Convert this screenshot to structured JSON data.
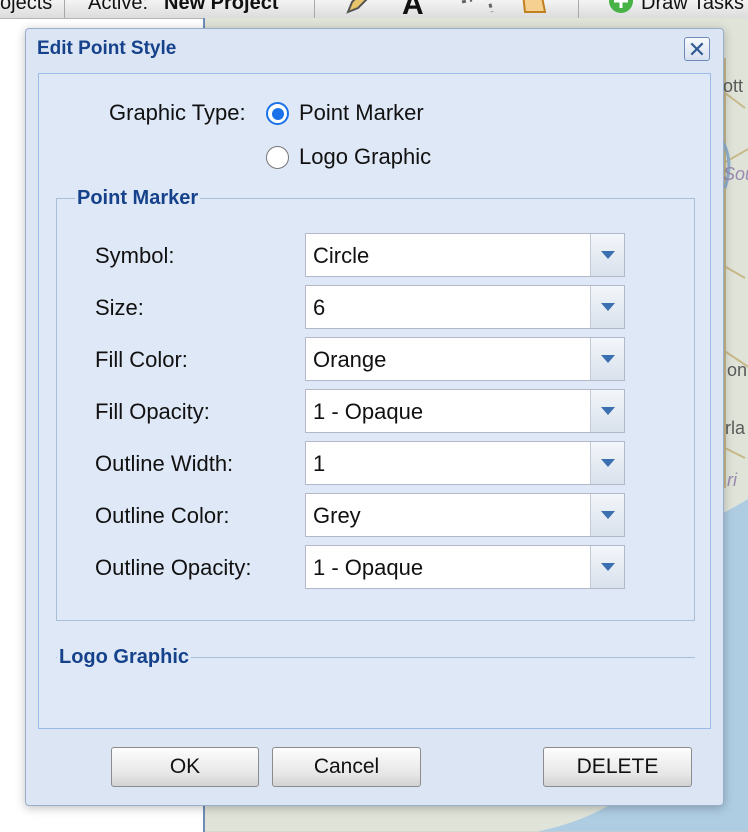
{
  "toolbar": {
    "projects_label": "ojects",
    "active_prefix": "Active:",
    "active_project": "New Project",
    "draw_tasks_label": "Draw Tasks"
  },
  "map": {
    "labels": [
      "ott",
      "Sou",
      "on",
      "rla",
      "ri"
    ]
  },
  "dialog": {
    "title": "Edit Point Style",
    "close_icon": "✕",
    "graphic_type_label": "Graphic Type:",
    "graphic_type_options": [
      {
        "label": "Point Marker",
        "checked": true
      },
      {
        "label": "Logo Graphic",
        "checked": false
      }
    ],
    "point_marker": {
      "legend": "Point Marker",
      "fields": [
        {
          "label": "Symbol:",
          "value": "Circle"
        },
        {
          "label": "Size:",
          "value": "6"
        },
        {
          "label": "Fill Color:",
          "value": "Orange"
        },
        {
          "label": "Fill Opacity:",
          "value": "1 - Opaque"
        },
        {
          "label": "Outline Width:",
          "value": "1"
        },
        {
          "label": "Outline Color:",
          "value": "Grey"
        },
        {
          "label": "Outline Opacity:",
          "value": "1 - Opaque"
        }
      ]
    },
    "logo_graphic": {
      "legend": "Logo Graphic"
    },
    "buttons": {
      "ok": "OK",
      "cancel": "Cancel",
      "delete": "DELETE"
    }
  },
  "colors": {
    "dialog_title": "#15428b",
    "radio_accent": "#1a73e8",
    "dialog_bg": "#dbe5f3"
  }
}
